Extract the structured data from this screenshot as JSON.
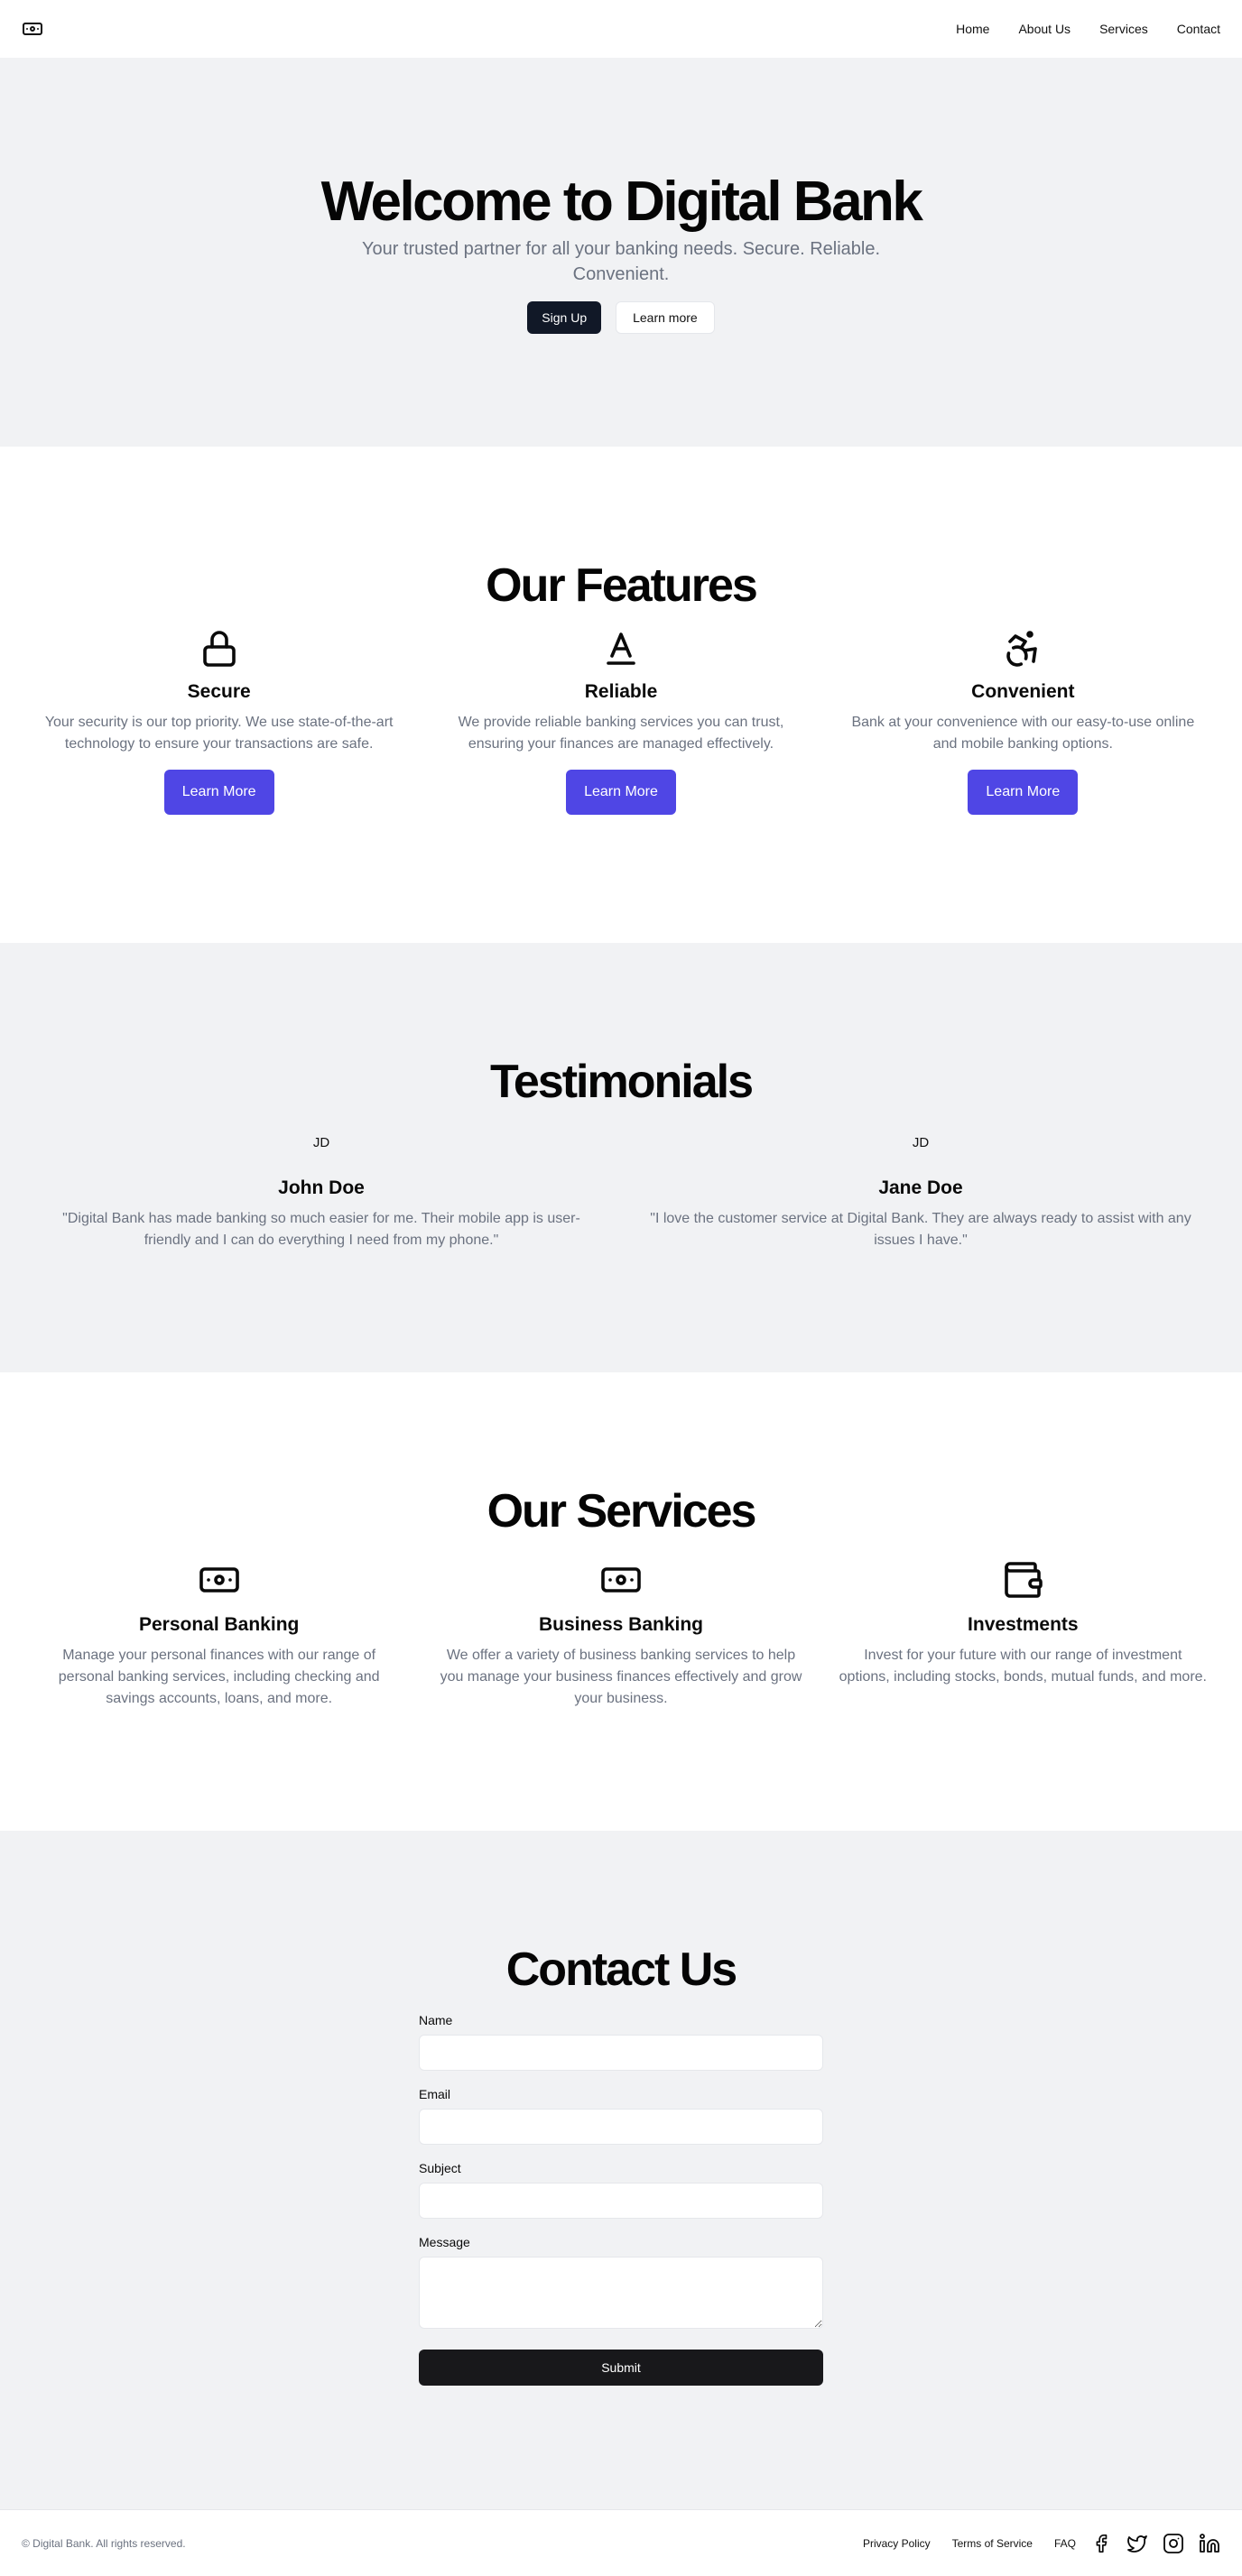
{
  "header": {
    "logo_icon": "banknote-icon",
    "nav": [
      "Home",
      "About Us",
      "Services",
      "Contact"
    ]
  },
  "hero": {
    "title": "Welcome to Digital Bank",
    "subtitle": "Your trusted partner for all your banking needs. Secure. Reliable. Convenient.",
    "primary_button": "Sign Up",
    "secondary_button": "Learn more",
    "primary_color": "#111827"
  },
  "features": {
    "title": "Our Features",
    "accent_color": "#4f46e5",
    "items": [
      {
        "icon": "lock-icon",
        "title": "Secure",
        "text": "Your security is our top priority. We use state-of-the-art technology to ensure your transactions are safe.",
        "button": "Learn More"
      },
      {
        "icon": "baseline-icon",
        "title": "Reliable",
        "text": "We provide reliable banking services you can trust, ensuring your finances are managed effectively.",
        "button": "Learn More"
      },
      {
        "icon": "accessibility-icon",
        "title": "Convenient",
        "text": "Bank at your convenience with our easy-to-use online and mobile banking options.",
        "button": "Learn More"
      }
    ]
  },
  "testimonials": {
    "title": "Testimonials",
    "items": [
      {
        "avatar": "JD",
        "name": "John Doe",
        "quote": "\"Digital Bank has made banking so much easier for me. Their mobile app is user-friendly and I can do everything I need from my phone.\""
      },
      {
        "avatar": "JD",
        "name": "Jane Doe",
        "quote": "\"I love the customer service at Digital Bank. They are always ready to assist with any issues I have.\""
      }
    ]
  },
  "services": {
    "title": "Our Services",
    "items": [
      {
        "icon": "banknote-icon",
        "title": "Personal Banking",
        "text": "Manage your personal finances with our range of personal banking services, including checking and savings accounts, loans, and more."
      },
      {
        "icon": "banknote-icon",
        "title": "Business Banking",
        "text": "We offer a variety of business banking services to help you manage your business finances effectively and grow your business."
      },
      {
        "icon": "wallet-icon",
        "title": "Investments",
        "text": "Invest for your future with our range of investment options, including stocks, bonds, mutual funds, and more."
      }
    ]
  },
  "contact": {
    "title": "Contact Us",
    "fields": {
      "name_label": "Name",
      "name_value": "",
      "email_label": "Email",
      "email_value": "",
      "subject_label": "Subject",
      "subject_value": "",
      "message_label": "Message",
      "message_value": ""
    },
    "submit": "Submit"
  },
  "footer": {
    "copyright": "© Digital Bank. All rights reserved.",
    "links": [
      "Privacy Policy",
      "Terms of Service",
      "FAQ"
    ],
    "socials": [
      "facebook-icon",
      "twitter-icon",
      "instagram-icon",
      "linkedin-icon"
    ]
  }
}
